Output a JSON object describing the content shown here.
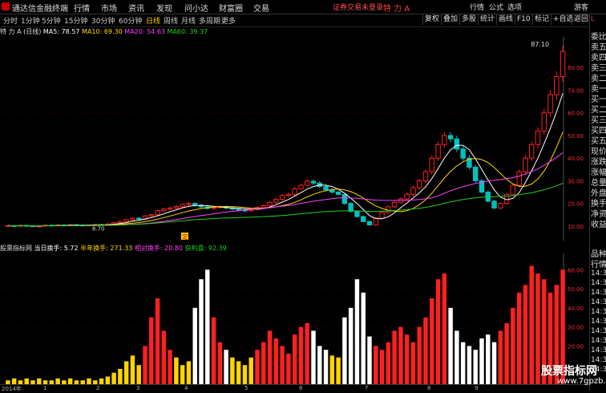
{
  "titlebar": {
    "app_name": "通达信金融终端",
    "menus": [
      "行情",
      "市场",
      "资讯",
      "发现",
      "问小达",
      "财富圈",
      "交易"
    ],
    "login_status": "证券交易未登录",
    "stock_name": "特 力 A",
    "right_items": [
      "行情",
      "公式",
      "选项"
    ],
    "guest": "游客"
  },
  "toolbar": {
    "periods": [
      "分时",
      "1分钟",
      "5分钟",
      "15分钟",
      "30分钟",
      "60分钟",
      "日线",
      "周线",
      "月线",
      "多周期",
      "更多"
    ],
    "active_period": "日线",
    "buttons": [
      "复权",
      "叠加",
      "多股",
      "统计",
      "画线",
      "F10",
      "标记",
      "+自选",
      "返回"
    ]
  },
  "indicator": {
    "title": "特 力 A (日线)",
    "ma5": "MA5: 78.57",
    "ma10": "MA10: 69.30",
    "ma20": "MA20: 54.63",
    "ma60": "MA60: 39.37"
  },
  "vol_indicator": {
    "title": "股票指标网",
    "today": "当日换手: 5.72",
    "half": "半年换手: 271.33",
    "rel": "相对换手: 20.80",
    "profit": "获利盘: 92.39"
  },
  "price_axis": [
    "80.00",
    "70.00",
    "60.00",
    "50.00",
    "40.00",
    "30.00",
    "20.00",
    "10.00"
  ],
  "vol_axis": [
    "60.00",
    "50.00",
    "40.00",
    "30.00",
    "20.00"
  ],
  "annotations": {
    "high_price": "87.10",
    "low_price": "8.70",
    "marker": "定"
  },
  "dates": [
    "2014年",
    "1",
    "2",
    "3",
    "4",
    "5",
    "6",
    "7",
    "8",
    "9"
  ],
  "sidebar_top": [
    "L",
    "委比",
    "卖五",
    "卖四",
    "卖三",
    "卖二",
    "卖一",
    "买一",
    "买二",
    "买三",
    "买四",
    "买五",
    "现价",
    "涨跌",
    "涨幅",
    "总量",
    "外盘",
    "换手",
    "净资",
    "收益"
  ],
  "sidebar_bottom": [
    "品种",
    "行情",
    "14:35",
    "14:35",
    "14:35",
    "14:35",
    "14:35",
    "14:35",
    "14:35",
    "14:35",
    "14:35",
    "14:35",
    "14:35"
  ],
  "watermark": {
    "line1": "股票指标网",
    "line2": "www.7gpzb.com"
  },
  "colors": {
    "up": "#ff2020",
    "down": "#00c0c0",
    "ma5": "#ffffff",
    "ma10": "#ffd400",
    "ma20": "#ff40ff",
    "ma60": "#20d020"
  },
  "chart_data": {
    "type": "bar",
    "series": [
      {
        "name": "close",
        "values": [
          10.2,
          10.0,
          10.3,
          10.1,
          9.9,
          10.0,
          10.4,
          10.2,
          10.5,
          10.3,
          10.6,
          10.4,
          10.2,
          10.5,
          10.7,
          10.5,
          10.9,
          11.5,
          12.0,
          12.8,
          13.5,
          13.0,
          14.5,
          15.0,
          16.8,
          17.5,
          18.0,
          18.6,
          19.5,
          20.0,
          19.2,
          18.5,
          17.8,
          18.2,
          18.6,
          18.0,
          17.5,
          17.0,
          16.8,
          17.5,
          18.2,
          19.0,
          20.5,
          21.8,
          23.5,
          24.0,
          26.5,
          28.0,
          29.8,
          29.0,
          27.5,
          26.0,
          25.0,
          24.0,
          20.0,
          16.5,
          14.2,
          12.0,
          10.5,
          13.5,
          16.0,
          18.5,
          20.5,
          22.0,
          24.0,
          27.0,
          30.0,
          34.0,
          40.0,
          46.0,
          50.0,
          48.5,
          44.0,
          40.0,
          36.0,
          30.0,
          25.0,
          21.0,
          18.0,
          20.0,
          24.0,
          28.0,
          34.0,
          40.0,
          46.0,
          52.0,
          60.0,
          68.0,
          76.0,
          87.1
        ]
      },
      {
        "name": "volume",
        "values": [
          2,
          3,
          2,
          3,
          2,
          3,
          2,
          2,
          3,
          2,
          3,
          2,
          2,
          3,
          2,
          3,
          4,
          6,
          8,
          12,
          15,
          10,
          20,
          35,
          45,
          28,
          18,
          14,
          10,
          12,
          40,
          55,
          60,
          35,
          22,
          18,
          14,
          12,
          10,
          14,
          18,
          22,
          28,
          24,
          20,
          16,
          26,
          30,
          32,
          28,
          20,
          18,
          15,
          14,
          35,
          40,
          55,
          48,
          25,
          20,
          18,
          22,
          28,
          30,
          26,
          22,
          30,
          35,
          45,
          55,
          58,
          40,
          28,
          22,
          20,
          18,
          24,
          26,
          22,
          28,
          32,
          40,
          48,
          52,
          62,
          58,
          55,
          48,
          52,
          60
        ]
      }
    ]
  }
}
